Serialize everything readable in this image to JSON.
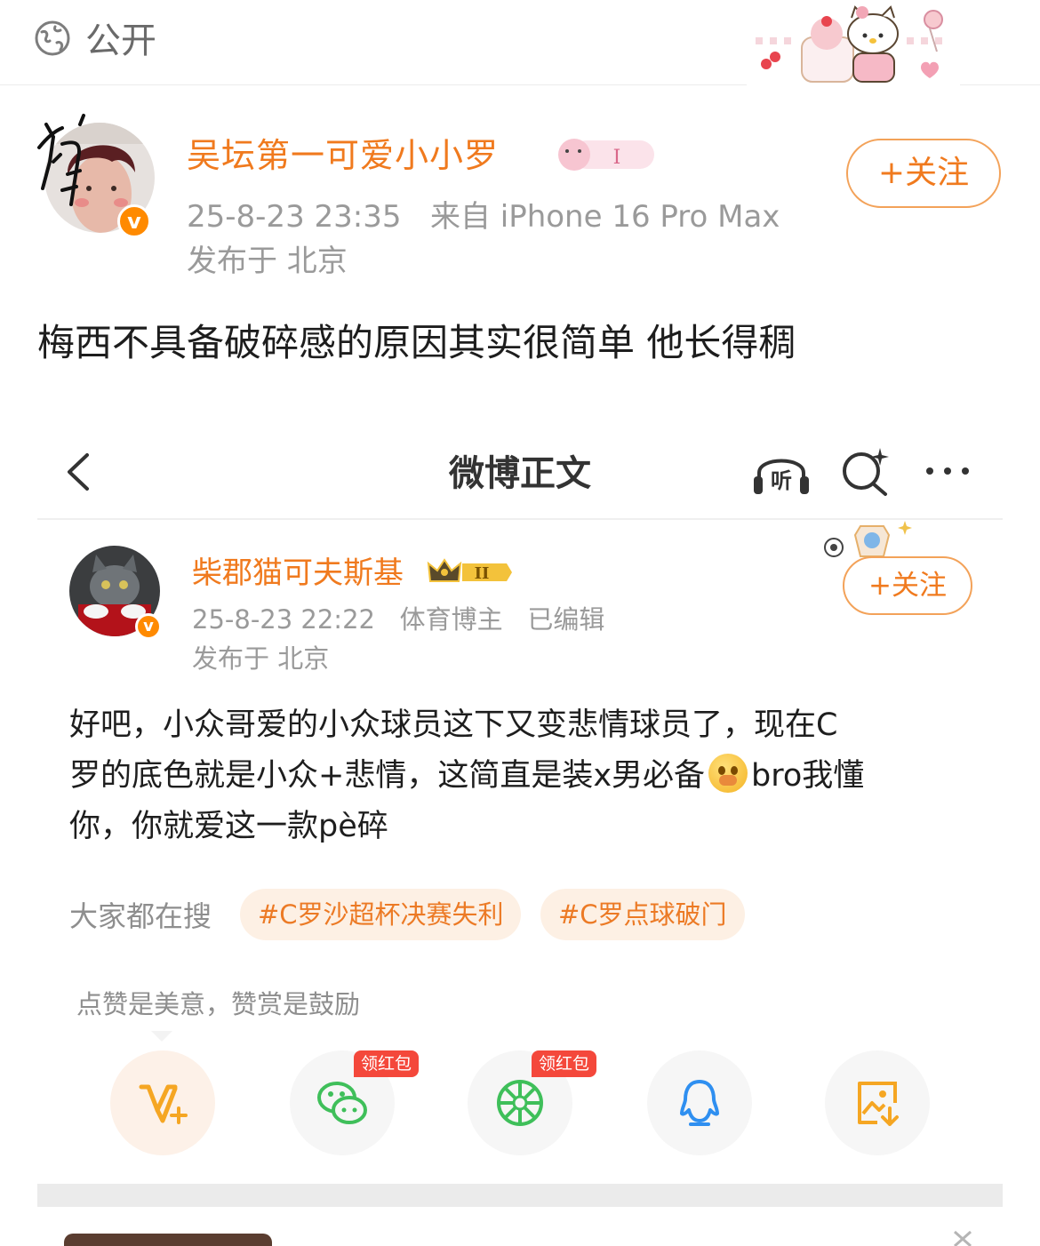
{
  "top": {
    "visibility_label": "公开"
  },
  "post": {
    "username": "吴坛第一可爱小小罗",
    "time": "25-8-23 23:35",
    "source": "来自 iPhone 16 Pro Max",
    "location": "发布于 北京",
    "follow_label": "+关注",
    "avatar_doodle": "狗",
    "verified_mark": "v",
    "text": "梅西不具备破碎感的原因其实很简单 他长得稠"
  },
  "embedded": {
    "page_title": "微博正文",
    "listen_label": "听",
    "author": {
      "name": "柴郡猫可夫斯基",
      "rank_badge": "II",
      "time": "25-8-23 22:22",
      "role": "体育博主",
      "edited": "已编辑",
      "location": "发布于 北京",
      "follow_label": "+关注",
      "verified_mark": "v"
    },
    "body_lines": {
      "line1": "好吧，小众哥爱的小众球员这下又变悲情球员了，现在C",
      "line2a": "罗的底色就是小众+悲情，这简直是装x男必备",
      "line2b": "bro我懂",
      "line3": "你，你就爱这一款pè碎"
    },
    "search_label": "大家都在搜",
    "tags": [
      "#C罗沙超杯决赛失利",
      "#C罗点球破门"
    ],
    "like_hint": "点赞是美意，赞赏是鼓励",
    "red_packet_label": "领红包",
    "share_icons": [
      "reward-icon",
      "wechat-icon",
      "moments-icon",
      "qq-icon",
      "save-image-icon"
    ],
    "colors": {
      "accent": "#f07a1e",
      "red_packet": "#f4483b",
      "wechat_green": "#3fbf5a",
      "qq_blue": "#2f8ff0",
      "save_orange": "#f5a623"
    }
  }
}
